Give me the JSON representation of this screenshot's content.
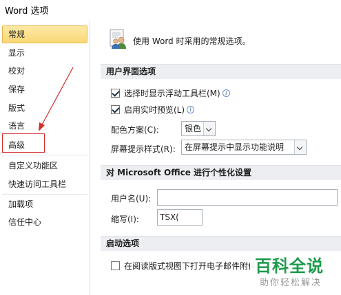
{
  "window": {
    "title": "Word 选项"
  },
  "sidebar": {
    "items": [
      {
        "label": "常规",
        "active": true
      },
      {
        "label": "显示"
      },
      {
        "label": "校对"
      },
      {
        "label": "保存"
      },
      {
        "label": "版式"
      },
      {
        "label": "语言"
      },
      {
        "label": "高级"
      },
      {
        "label": "自定义功能区"
      },
      {
        "label": "快速访问工具栏"
      },
      {
        "label": "加载项"
      },
      {
        "label": "信任中心"
      }
    ]
  },
  "main": {
    "header_text": "使用 Word 时采用的常规选项。",
    "header_icon": "options-people-icon",
    "sections": {
      "ui": {
        "title": "用户界面选项",
        "mini_toolbar_label": "选择时显示浮动工具栏(M)",
        "mini_toolbar_checked": true,
        "live_preview_label": "启用实时预览(L)",
        "live_preview_checked": true,
        "color_scheme_label": "配色方案(C):",
        "color_scheme_value": "银色",
        "screentip_label": "屏幕提示样式(R):",
        "screentip_value": "在屏幕提示中显示功能说明"
      },
      "personalize": {
        "title": "对 Microsoft Office 进行个性化设置",
        "username_label": "用户名(U):",
        "username_value": "",
        "initials_label": "缩写(I):",
        "initials_value": "TSX("
      },
      "startup": {
        "title": "启动选项",
        "reading_view_label": "在阅读版式视图下打开电子邮件附件",
        "reading_view_checked": false
      }
    }
  },
  "watermark": {
    "logo": "百科全说",
    "subtitle": "助你轻松解决"
  },
  "colors": {
    "accent_active": "#f9d775",
    "highlight_border": "#d42b2b",
    "watermark_green": "#1d9a4c"
  }
}
